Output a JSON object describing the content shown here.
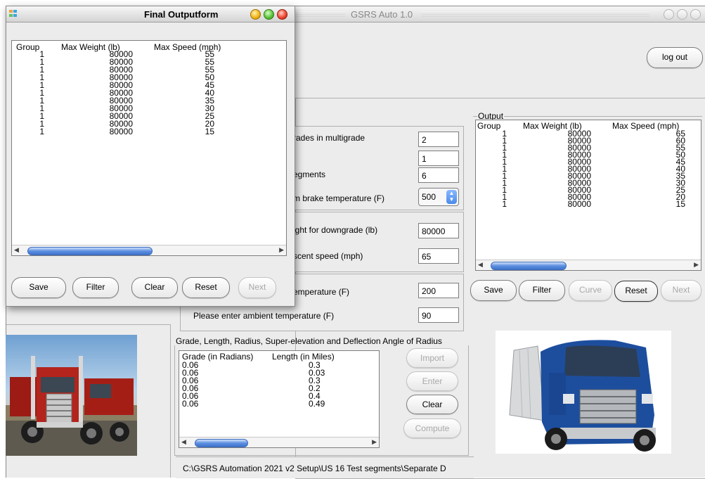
{
  "main_window": {
    "title": "GSRS Auto 1.0",
    "logout_label": "log out"
  },
  "input_form": {
    "fields": [
      {
        "label": "rades in multigrade",
        "value": "2"
      },
      {
        "label": "",
        "value": "1"
      },
      {
        "label": "egments",
        "value": "6"
      },
      {
        "label": "m brake temperature (F)",
        "value": "500"
      },
      {
        "label": "ight for downgrade (lb)",
        "value": "80000"
      },
      {
        "label": "scent speed (mph)",
        "value": "65"
      },
      {
        "label": "emperature (F)",
        "value": "200"
      },
      {
        "label": "Please enter ambient temperature (F)",
        "value": "90"
      }
    ],
    "grade_section_title": "Grade, Length, Radius, Super-elevation and Deflection Angle of Radius",
    "grade_table": {
      "headers": [
        "Grade (in Radians)",
        "Length (in Miles)"
      ],
      "rows": [
        [
          "0.06",
          "0.3"
        ],
        [
          "0.06",
          "0.03"
        ],
        [
          "0.06",
          "0.3"
        ],
        [
          "0.06",
          "0.2"
        ],
        [
          "0.06",
          "0.4"
        ],
        [
          "0.06",
          "0.49"
        ]
      ]
    },
    "buttons": {
      "import": "Import",
      "enter": "Enter",
      "clear": "Clear",
      "compute": "Compute"
    },
    "path_text": "C:\\GSRS Automation 2021 v2  Setup\\US 16 Test segments\\Separate D"
  },
  "output_panel": {
    "legend": "Output",
    "headers": [
      "Group",
      "Max Weight (lb)",
      "Max Speed (mph)"
    ],
    "rows": [
      [
        "1",
        "80000",
        "65"
      ],
      [
        "1",
        "80000",
        "60"
      ],
      [
        "1",
        "80000",
        "55"
      ],
      [
        "1",
        "80000",
        "50"
      ],
      [
        "1",
        "80000",
        "45"
      ],
      [
        "1",
        "80000",
        "40"
      ],
      [
        "1",
        "80000",
        "35"
      ],
      [
        "1",
        "80000",
        "30"
      ],
      [
        "1",
        "80000",
        "25"
      ],
      [
        "1",
        "80000",
        "20"
      ],
      [
        "1",
        "80000",
        "15"
      ]
    ],
    "buttons": {
      "save": "Save",
      "filter": "Filter",
      "curve": "Curve",
      "reset": "Reset",
      "next": "Next"
    }
  },
  "final_window": {
    "title": "Final Outputform",
    "headers": [
      "Group",
      "Max Weight (lb)",
      "Max Speed (mph)"
    ],
    "rows": [
      [
        "1",
        "80000",
        "55"
      ],
      [
        "1",
        "80000",
        "55"
      ],
      [
        "1",
        "80000",
        "55"
      ],
      [
        "1",
        "80000",
        "50"
      ],
      [
        "1",
        "80000",
        "45"
      ],
      [
        "1",
        "80000",
        "40"
      ],
      [
        "1",
        "80000",
        "35"
      ],
      [
        "1",
        "80000",
        "30"
      ],
      [
        "1",
        "80000",
        "25"
      ],
      [
        "1",
        "80000",
        "20"
      ],
      [
        "1",
        "80000",
        "15"
      ]
    ],
    "buttons": {
      "save": "Save",
      "filter": "Filter",
      "clear": "Clear",
      "reset": "Reset",
      "next": "Next"
    }
  },
  "colors": {
    "accent_blue": "#3f74cc",
    "stepper_blue": "#4a8bea"
  },
  "icons": [
    "app-icon",
    "spinner-arrows-icon",
    "scroll-left-arrow-icon",
    "scroll-right-arrow-icon"
  ]
}
